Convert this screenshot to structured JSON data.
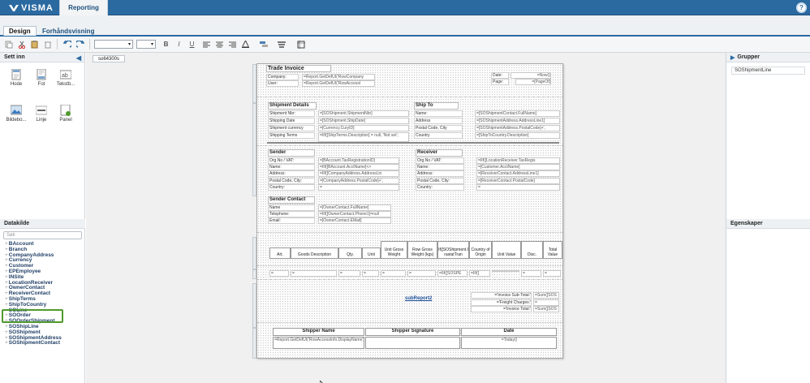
{
  "app": {
    "brand": "VISMA",
    "name": "Reporting",
    "help_icon": "question-circle-icon"
  },
  "tabs": [
    {
      "label": "Design",
      "active": true
    },
    {
      "label": "Forhåndsvisning",
      "active": false
    }
  ],
  "toolbar": {
    "font_select": "",
    "size_select": "",
    "bold": "B",
    "italic": "I",
    "underline": "U"
  },
  "left_panel": {
    "title": "Sett inn",
    "tools": [
      {
        "label": "Hode",
        "icon": "header-icon"
      },
      {
        "label": "Fot",
        "icon": "footer-icon"
      },
      {
        "label": "Tekstb...",
        "icon": "textbox-icon"
      },
      {
        "label": "Bildebo...",
        "icon": "picturebox-icon"
      },
      {
        "label": "Linje",
        "icon": "line-icon"
      },
      {
        "label": "Panel",
        "icon": "panel-icon"
      }
    ],
    "datasource_title": "Datakilde",
    "search_placeholder": "Søk",
    "datasources": [
      "BAccount",
      "Branch",
      "CompanyAddress",
      "Currency",
      "Customer",
      "EPEmployee",
      "INSite",
      "LocationReceiver",
      "OwnerContact",
      "ReceiverContact",
      "ShipTerms",
      "ShipToCountry",
      "SOLine",
      "SOOrder",
      "SOOrderShipment",
      "SOShipLine",
      "SOShipment",
      "SOShipmentAddress",
      "SOShipmentContact"
    ]
  },
  "doc_tab": "so64300s",
  "report": {
    "title": "Trade Invoice",
    "company_lbl": "Company:",
    "company_val": "=Report.GetDefUI('RowCompany",
    "user_lbl": "User:",
    "user_val": "=Report.GetDefUI('RowAccessI",
    "date_lbl": "Date:",
    "date_val": "=Now()",
    "page_lbl": "Page:",
    "page_val": "=[PageOf]",
    "shipment_details": "Shipment Details",
    "ship_to": "Ship To",
    "sd_rows": [
      {
        "l": "Shipment Nbr:",
        "v": "=[SOShipment.ShipmentNbr]"
      },
      {
        "l": "Shipping Date",
        "v": "=[SOShipment.ShipDate]"
      },
      {
        "l": "Shipment currency",
        "v": "=[Currency.CuryID]"
      },
      {
        "l": "Shipping Terms",
        "v": "=IIf([ShipTerms.Description] = null, 'Not set',"
      }
    ],
    "st_rows": [
      {
        "l": "Name:",
        "v": "=[SOShipmentContact.FullName]"
      },
      {
        "l": "Address",
        "v": "=[SOShipmentAddress.AddressLine1]"
      },
      {
        "l": "Postal Code, City",
        "v": "=[SOShipmentAddress.PostalCode]+',"
      },
      {
        "l": "Country",
        "v": "=[ShipToCountry.Description]"
      }
    ],
    "sender": "Sender",
    "receiver": "Receiver",
    "sender_rows": [
      {
        "l": "Org.No / VAT:",
        "v": "=[BAccount.TaxRegistrationID]"
      },
      {
        "l": "Name:",
        "v": "=IIf([BAccount.AcctName]<>"
      },
      {
        "l": "Address:",
        "v": "=IIf([CompanyAddress.AddressLin"
      },
      {
        "l": "Postal Code, City:",
        "v": "=[CompanyAddress.PostalCode]+',"
      },
      {
        "l": "Country:",
        "v": "="
      }
    ],
    "receiver_rows": [
      {
        "l": "Org.No / VAT:",
        "v": "=IIf([LocationReceiver.TaxRegis"
      },
      {
        "l": "Name:",
        "v": "=[Customer.AcctName]"
      },
      {
        "l": "Address:",
        "v": "=[ReceiverContact.AddressLine1]"
      },
      {
        "l": "Postal Code, City:",
        "v": "=[ReceiverContact.PostalCode]"
      },
      {
        "l": "Country:",
        "v": "="
      }
    ],
    "sender_contact": "Sender Contact",
    "sc_rows": [
      {
        "l": "Name",
        "v": "=[OwnerContact.FullName]"
      },
      {
        "l": "Telephone:",
        "v": "=IIf([OwnerContact.Phone1]=null"
      },
      {
        "l": "Email:",
        "v": "=[OwnerContact.EMail]"
      }
    ],
    "columns": [
      "Art.",
      "Goods Description",
      "Qty.",
      "Unit",
      "Unit Gross Weight",
      "Row Gross Weight (kgs)",
      "=IIf([SOShipment.Int rastatTran",
      "Country of Origin",
      "Unit Value",
      "Disc.",
      "Total Value"
    ],
    "row_vals": [
      "=",
      "=",
      "=",
      "=",
      "=",
      "=",
      "=IIf([SOSPE",
      "=IIf([",
      "",
      "=",
      "="
    ],
    "subreport": "subReport2",
    "totals": [
      {
        "l": "='Invoice Sub-Total:'",
        "v": "=Sum([SOS"
      },
      {
        "l": "='Freight Charges:'",
        "v": "="
      },
      {
        "l": "='Invoice Total:'",
        "v": "=Sum([SOS"
      }
    ],
    "footer_cols": [
      "Shipper Name",
      "Shipper Signature",
      "Date"
    ],
    "footer_vals": [
      "=Report.GetDefUI('RowAccessInfo.DisplayName')",
      "",
      "=Today()"
    ]
  },
  "right_panel": {
    "groups_title": "Grupper",
    "group_item": "SOShipmentLine",
    "props_title": "Egenskaper"
  }
}
